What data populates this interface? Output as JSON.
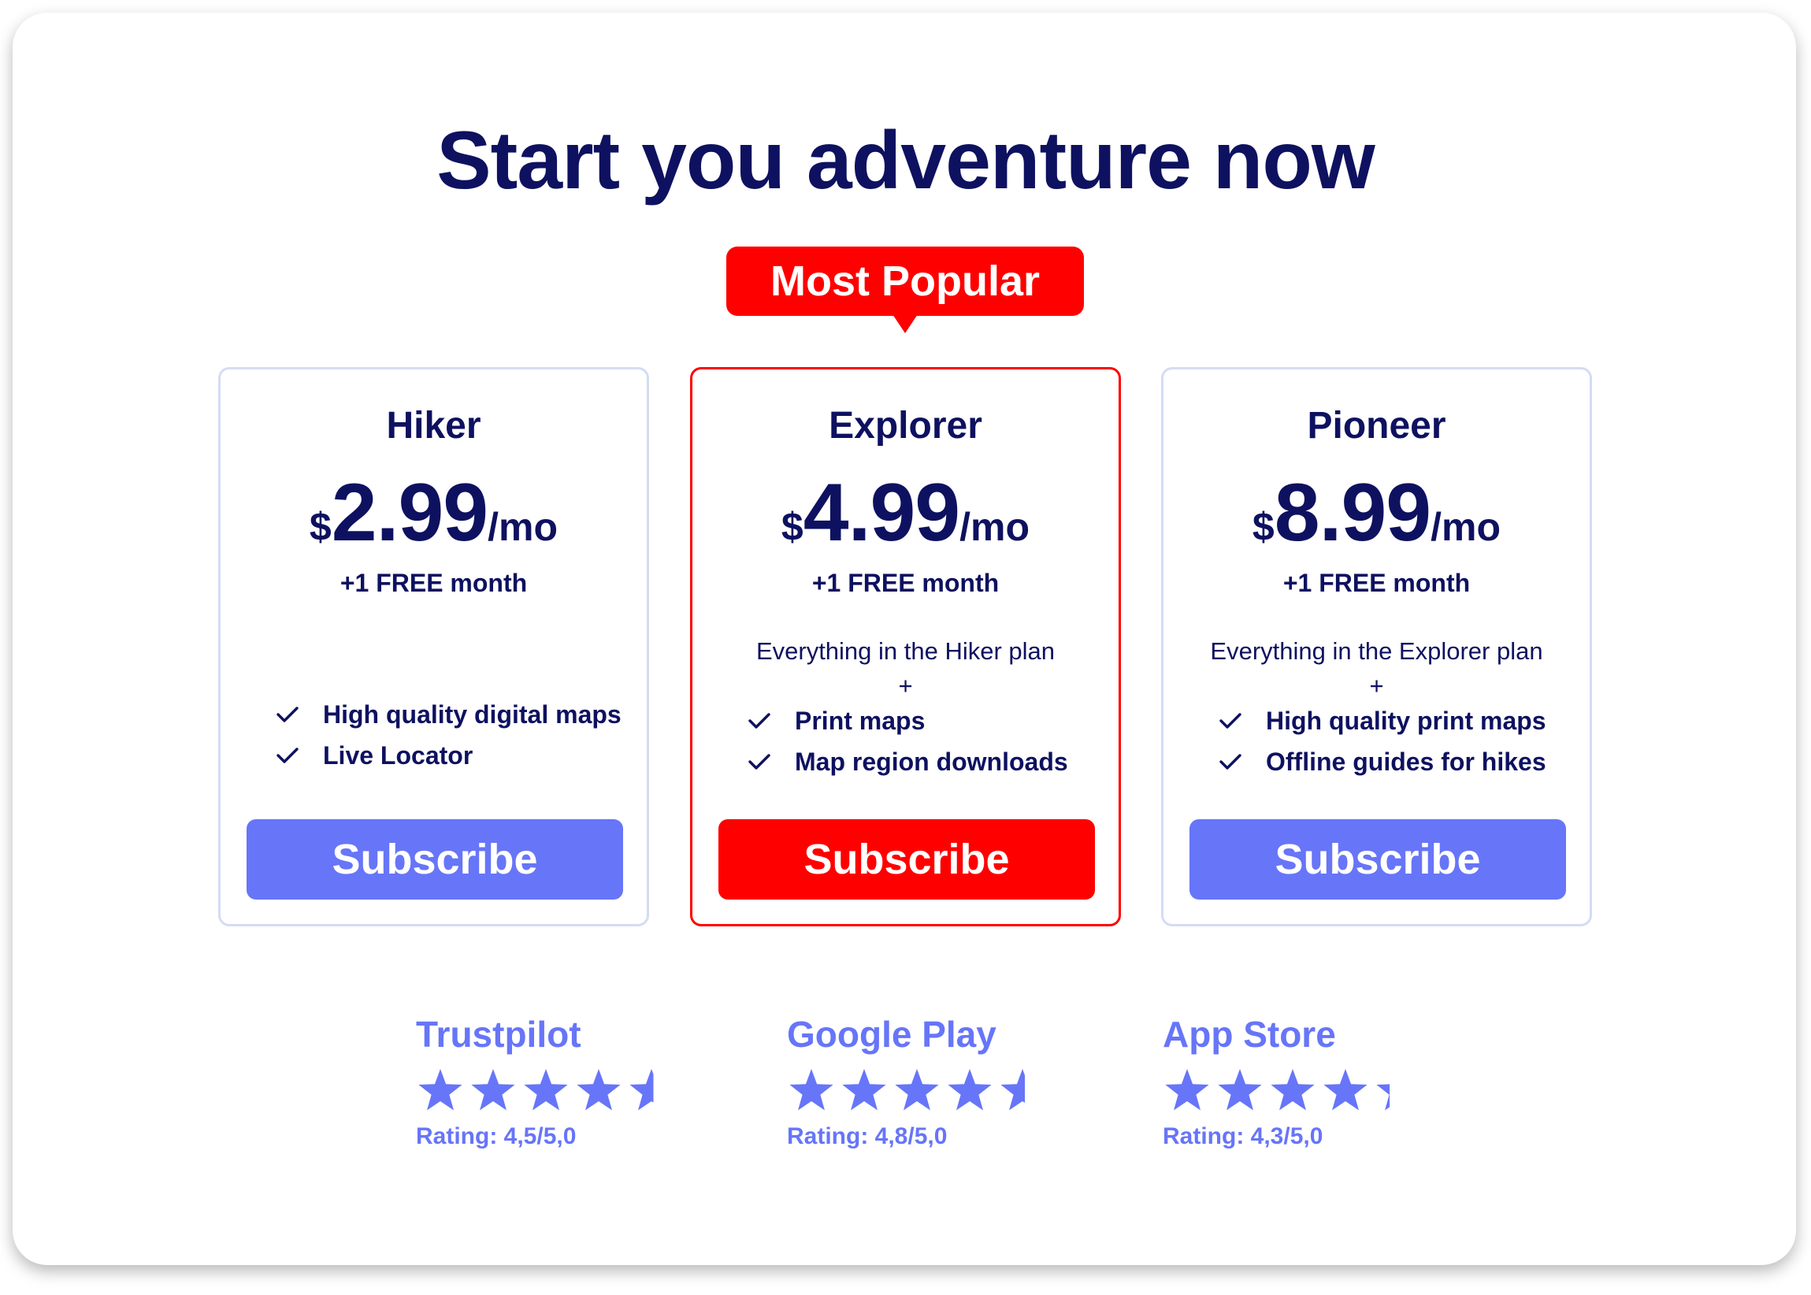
{
  "page": {
    "title": "Start you adventure now",
    "badge": "Most Popular"
  },
  "colors": {
    "navy": "#0e1160",
    "accent": "#6775f8",
    "popular": "#ff0000",
    "card_border": "#d4dcf5"
  },
  "plans": [
    {
      "name": "Hiker",
      "currency": "$",
      "amount": "2.99",
      "period": "/mo",
      "bonus": "+1 FREE month",
      "includes": "",
      "plus": "",
      "features": [
        "High quality digital maps",
        "Live Locator"
      ],
      "button": "Subscribe",
      "icon": "check-icon"
    },
    {
      "name": "Explorer",
      "currency": "$",
      "amount": "4.99",
      "period": "/mo",
      "bonus": "+1 FREE month",
      "includes": "Everything in the Hiker plan",
      "plus": "+",
      "features": [
        "Print maps",
        "Map region downloads"
      ],
      "button": "Subscribe",
      "icon": "check-icon"
    },
    {
      "name": "Pioneer",
      "currency": "$",
      "amount": "8.99",
      "period": "/mo",
      "bonus": "+1 FREE month",
      "includes": "Everything in the Explorer plan",
      "plus": "+",
      "features": [
        "High quality print maps",
        "Offline guides for hikes"
      ],
      "button": "Subscribe",
      "icon": "check-icon"
    }
  ],
  "ratings": [
    {
      "source": "Trustpilot",
      "stars": 4.5,
      "max": 5,
      "label": "Rating: 4,5/5,0",
      "icon": "star-icon"
    },
    {
      "source": "Google Play",
      "stars": 4.8,
      "max": 5,
      "label": "Rating: 4,8/5,0",
      "icon": "star-icon"
    },
    {
      "source": "App Store",
      "stars": 4.3,
      "max": 5,
      "label": "Rating: 4,3/5,0",
      "icon": "star-icon"
    }
  ]
}
